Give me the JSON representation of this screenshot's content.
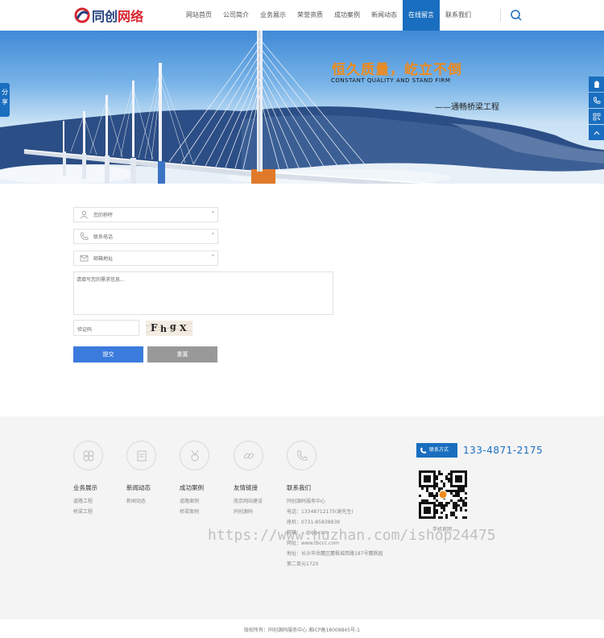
{
  "brand": {
    "logo_text_blue": "同创",
    "logo_text_red": "网络",
    "accent_color": "#1a6ebf",
    "orange_color": "#f08b1c"
  },
  "nav": {
    "items": [
      {
        "label": "网站首页",
        "active": false
      },
      {
        "label": "公司简介",
        "active": false
      },
      {
        "label": "业务展示",
        "active": false
      },
      {
        "label": "荣誉资质",
        "active": false
      },
      {
        "label": "成功案例",
        "active": false
      },
      {
        "label": "新闻动态",
        "active": false
      },
      {
        "label": "在线留言",
        "active": true
      },
      {
        "label": "联系我们",
        "active": false
      }
    ],
    "search_icon": "search-icon"
  },
  "banner": {
    "slogan_cn": "恒久质量，屹立不倒",
    "slogan_en": "CONSTANT QUALITY  AND STAND FIRM",
    "slogan_sub": "——通畅桥梁工程"
  },
  "share": {
    "label": "分享"
  },
  "side_tools": [
    "qq-icon",
    "phone-icon",
    "qr-icon",
    "up-arrow-icon"
  ],
  "form": {
    "name_placeholder": "您的称呼",
    "phone_placeholder": "联系电话",
    "email_placeholder": "邮箱地址",
    "required_mark": "*",
    "message_placeholder": "请填写您的需求信息...",
    "captcha_placeholder": "验证码",
    "captcha_text": "FhgX",
    "submit_label": "提交",
    "reset_label": "重置"
  },
  "footer": {
    "columns": [
      {
        "title": "业务展示",
        "icon": "grid-flower-icon",
        "links": [
          "道路工程",
          "桥梁工程"
        ]
      },
      {
        "title": "新闻动态",
        "icon": "document-icon",
        "links": [
          "新闻动态"
        ]
      },
      {
        "title": "成功案例",
        "icon": "medal-icon",
        "links": [
          "道路案例",
          "桥梁案例"
        ]
      },
      {
        "title": "友情链接",
        "icon": "link-icon",
        "links": [
          "南京网站建设",
          "同创源码"
        ]
      },
      {
        "title": "联系我们",
        "icon": "phone-ring-icon",
        "links": [
          "同创源码服务中心",
          "电话：13348712175(谢先生)",
          "座机：0731-85838839",
          "邮箱：...@qq.com",
          "网址：www.tbccc.com",
          "地址：长沙市岳麓区麓枫城西路187号麓枫园",
          "第二单元1720"
        ]
      }
    ],
    "contact_badge": "联系方式",
    "contact_phone": "133-4871-2175",
    "qr_label": "手机官网",
    "copyright": "版权所有：同创源码服务中心 湘ICP备18008845号-1"
  },
  "watermark": "https://www.huzhan.com/ishop24475"
}
